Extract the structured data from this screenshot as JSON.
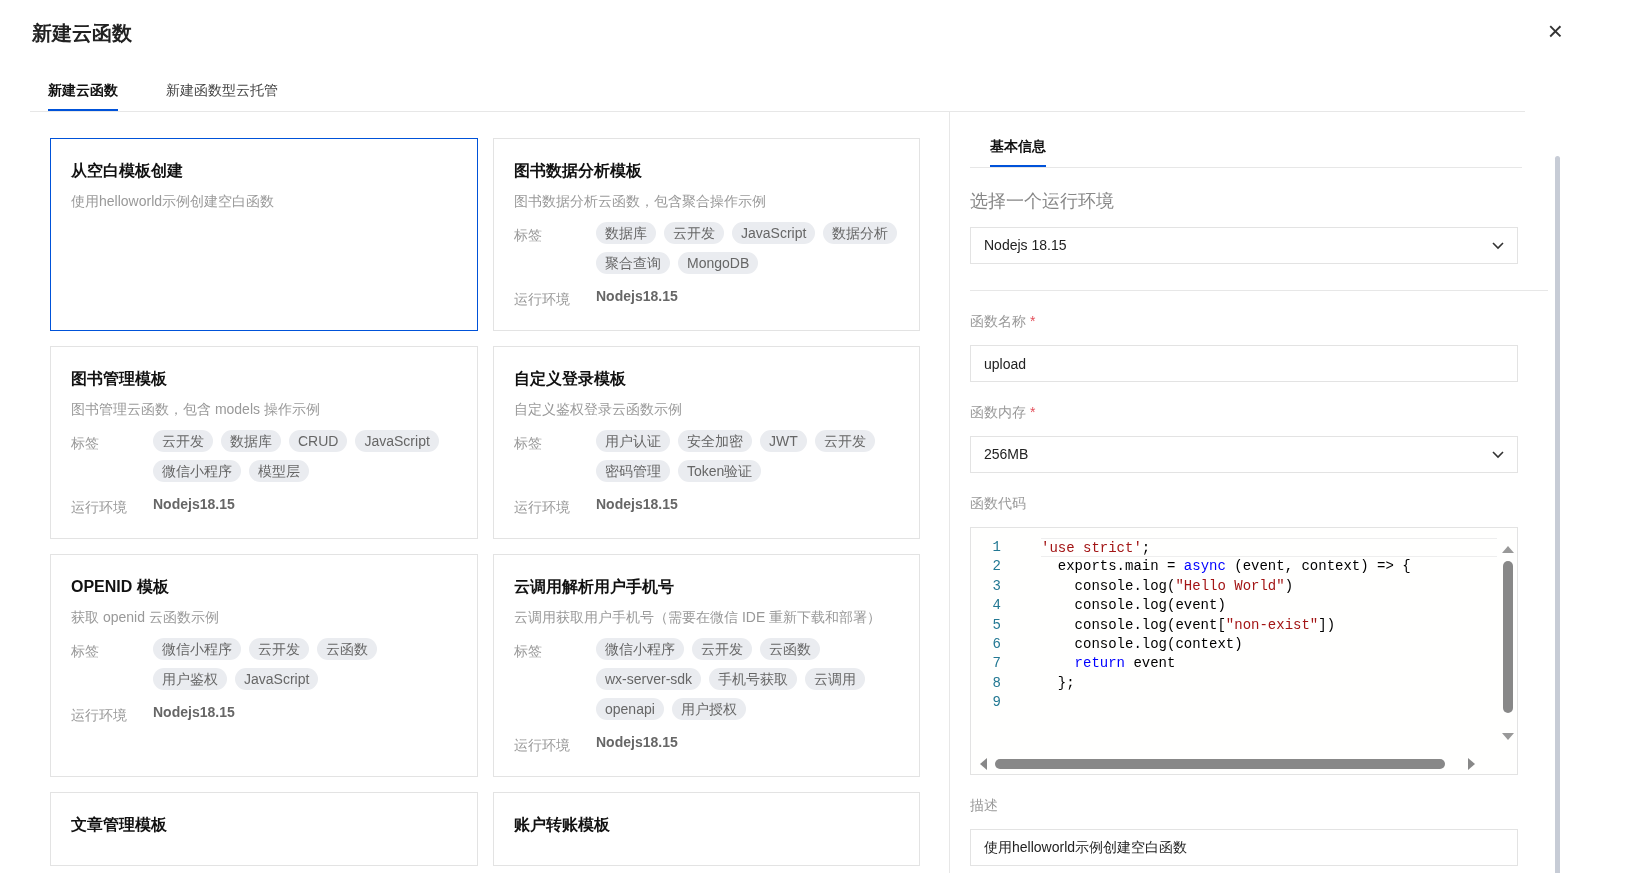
{
  "dialog": {
    "title": "新建云函数",
    "close": "×"
  },
  "tabs": [
    {
      "label": "新建云函数",
      "selected": true
    },
    {
      "label": "新建函数型云托管",
      "selected": false
    }
  ],
  "templates": [
    {
      "title": "从空白模板创建",
      "description": "使用helloworld示例创建空白函数",
      "selected": true
    },
    {
      "title": "图书数据分析模板",
      "description": "图书数据分析云函数，包含聚合操作示例",
      "selected": false,
      "tags_label": "标签",
      "tags": [
        "数据库",
        "云开发",
        "JavaScript",
        "数据分析",
        "聚合查询",
        "MongoDB"
      ],
      "runtime_label": "运行环境",
      "runtime": "Nodejs18.15"
    },
    {
      "title": "图书管理模板",
      "description": "图书管理云函数，包含 models 操作示例",
      "selected": false,
      "tags_label": "标签",
      "tags": [
        "云开发",
        "数据库",
        "CRUD",
        "JavaScript",
        "微信小程序",
        "模型层"
      ],
      "runtime_label": "运行环境",
      "runtime": "Nodejs18.15"
    },
    {
      "title": "自定义登录模板",
      "description": "自定义鉴权登录云函数示例",
      "selected": false,
      "tags_label": "标签",
      "tags": [
        "用户认证",
        "安全加密",
        "JWT",
        "云开发",
        "密码管理",
        "Token验证"
      ],
      "runtime_label": "运行环境",
      "runtime": "Nodejs18.15"
    },
    {
      "title": "OPENID 模板",
      "description": "获取 openid 云函数示例",
      "selected": false,
      "tags_label": "标签",
      "tags": [
        "微信小程序",
        "云开发",
        "云函数",
        "用户鉴权",
        "JavaScript"
      ],
      "runtime_label": "运行环境",
      "runtime": "Nodejs18.15"
    },
    {
      "title": "云调用解析用户手机号",
      "description": "云调用获取用户手机号（需要在微信 IDE 重新下载和部署）",
      "selected": false,
      "tags_label": "标签",
      "tags": [
        "微信小程序",
        "云开发",
        "云函数",
        "wx-server-sdk",
        "手机号获取",
        "云调用",
        "openapi",
        "用户授权"
      ],
      "runtime_label": "运行环境",
      "runtime": "Nodejs18.15"
    },
    {
      "title": "文章管理模板",
      "selected": false
    },
    {
      "title": "账户转账模板",
      "selected": false
    }
  ],
  "side_panel": {
    "tabs": [
      {
        "label": "基本信息",
        "selected": true
      }
    ],
    "runtime_heading": "选择一个运行环境",
    "runtime_select": {
      "value": "Nodejs 18.15"
    },
    "fields": [
      {
        "kind": "input",
        "label": "函数名称",
        "required_mark": "*",
        "value": "upload"
      },
      {
        "kind": "select",
        "label": "函数内存",
        "required_mark": "*",
        "value": "256MB"
      },
      {
        "kind": "code",
        "label": "函数代码",
        "lines": [
          {
            "tokens": [
              {
                "kind": "string",
                "text": "'use strict'"
              },
              {
                "kind": "plain",
                "text": ";"
              }
            ]
          },
          {
            "tokens": [
              {
                "kind": "plain",
                "text": "  exports.main = "
              },
              {
                "kind": "keyword",
                "text": "async"
              },
              {
                "kind": "plain",
                "text": " (event, context) => {"
              }
            ],
            "children": [
              {
                "tokens": [
                  {
                    "kind": "plain",
                    "text": "console.log("
                  },
                  {
                    "kind": "string",
                    "text": "\"Hello World\""
                  },
                  {
                    "kind": "plain",
                    "text": ")"
                  }
                ]
              },
              {
                "tokens": [
                  {
                    "kind": "plain",
                    "text": "console.log(event)"
                  }
                ]
              },
              {
                "tokens": [
                  {
                    "kind": "plain",
                    "text": "console.log(event["
                  },
                  {
                    "kind": "string",
                    "text": "\"non-exist\""
                  },
                  {
                    "kind": "plain",
                    "text": "])"
                  }
                ]
              },
              {
                "tokens": [
                  {
                    "kind": "plain",
                    "text": "console.log(context)"
                  }
                ]
              },
              {
                "tokens": [
                  {
                    "kind": "keyword",
                    "text": "return"
                  },
                  {
                    "kind": "plain",
                    "text": " event"
                  }
                ]
              }
            ]
          },
          {
            "tokens": [
              {
                "kind": "plain",
                "text": "  };"
              }
            ]
          }
        ],
        "line_numbers": [
          "1",
          "2",
          "3",
          "4",
          "5",
          "6",
          "7",
          "8",
          "9"
        ]
      },
      {
        "kind": "input",
        "label": "描述",
        "value": "使用helloworld示例创建空白函数"
      }
    ]
  }
}
